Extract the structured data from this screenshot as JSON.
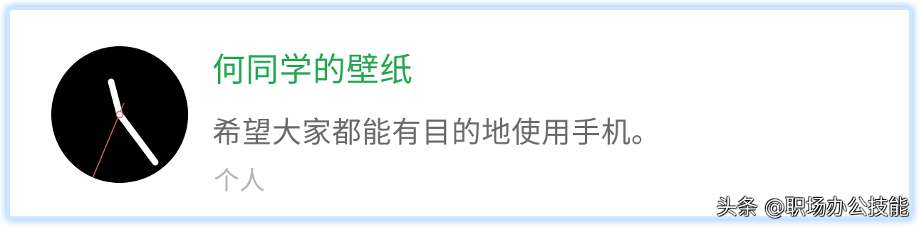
{
  "account": {
    "name": "何同学的壁纸",
    "description": "希望大家都能有目的地使用手机。",
    "type": "个人"
  },
  "avatar": {
    "icon": "clock-face-icon",
    "background_color": "#000000",
    "hand_color": "#ffffff",
    "second_hand_color": "#d06a6a"
  },
  "watermark": {
    "text": "头条 @职场办公技能"
  },
  "colors": {
    "name": "#22a851",
    "description": "#6b6b6b",
    "type": "#b4b4b4",
    "frame_glow": "#a9d2ff"
  }
}
